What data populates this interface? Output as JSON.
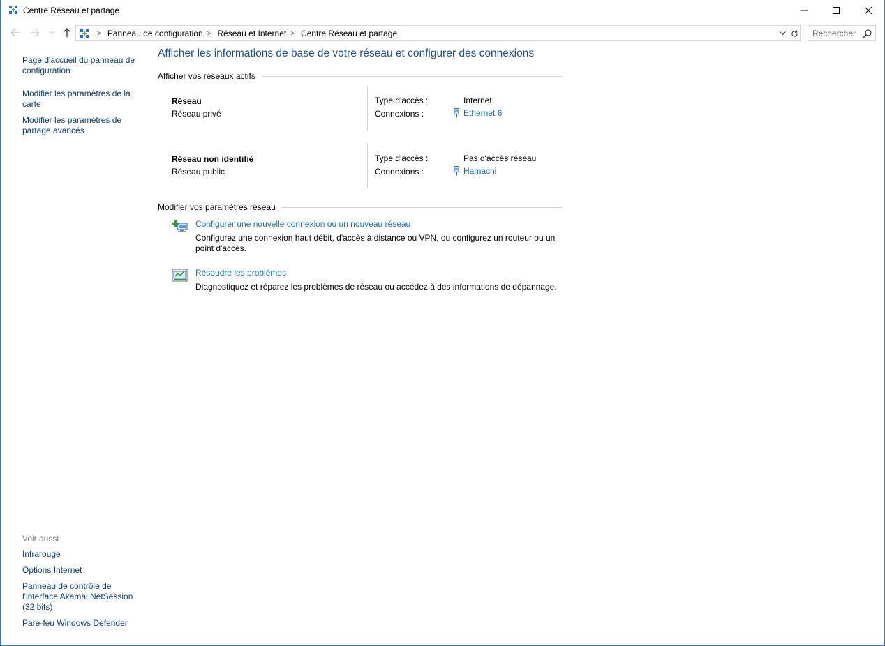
{
  "window": {
    "title": "Centre Réseau et partage"
  },
  "address": {
    "breadcrumbs": [
      "Panneau de configuration",
      "Réseau et Internet",
      "Centre Réseau et partage"
    ],
    "search_placeholder": "Rechercher"
  },
  "left_pane": {
    "links": [
      {
        "label": "Page d'accueil du panneau de configuration"
      },
      {
        "label": "Modifier les paramètres de la carte"
      },
      {
        "label": "Modifier les paramètres de partage avancés"
      }
    ],
    "see_also_title": "Voir aussi",
    "see_also": [
      {
        "label": "Infrarouge"
      },
      {
        "label": "Options Internet"
      },
      {
        "label": "Panneau de contrôle de l'interface Akamai NetSession (32 bits)"
      },
      {
        "label": "Pare-feu Windows Defender"
      }
    ]
  },
  "main": {
    "title": "Afficher les informations de base de votre réseau et configurer des connexions",
    "active_networks_heading": "Afficher vos réseaux actifs",
    "networks": [
      {
        "name": "Réseau",
        "type": "Réseau privé",
        "access_label": "Type d'accès :",
        "access_value": "Internet",
        "connections_label": "Connexions :",
        "connection": "Ethernet 6"
      },
      {
        "name": "Réseau non identifié",
        "type": "Réseau public",
        "access_label": "Type d'accès :",
        "access_value": "Pas d'accès réseau",
        "connections_label": "Connexions :",
        "connection": "Hamachi"
      }
    ],
    "change_settings_heading": "Modifier vos paramètres réseau",
    "tasks": [
      {
        "icon": "new-connection-icon",
        "link": "Configurer une nouvelle connexion ou un nouveau réseau",
        "description": "Configurez une connexion haut débit, d'accès à distance ou VPN, ou configurez un routeur ou un point d'accès."
      },
      {
        "icon": "troubleshoot-icon",
        "link": "Résoudre les problèmes",
        "description": "Diagnostiquez et réparez les problèmes de réseau ou accédez à des informations de dépannage."
      }
    ]
  },
  "colors": {
    "link": "#1a6fb5",
    "left_link": "#0a3d7a",
    "title": "#1e4e8c",
    "window_border": "#2b79d3"
  }
}
